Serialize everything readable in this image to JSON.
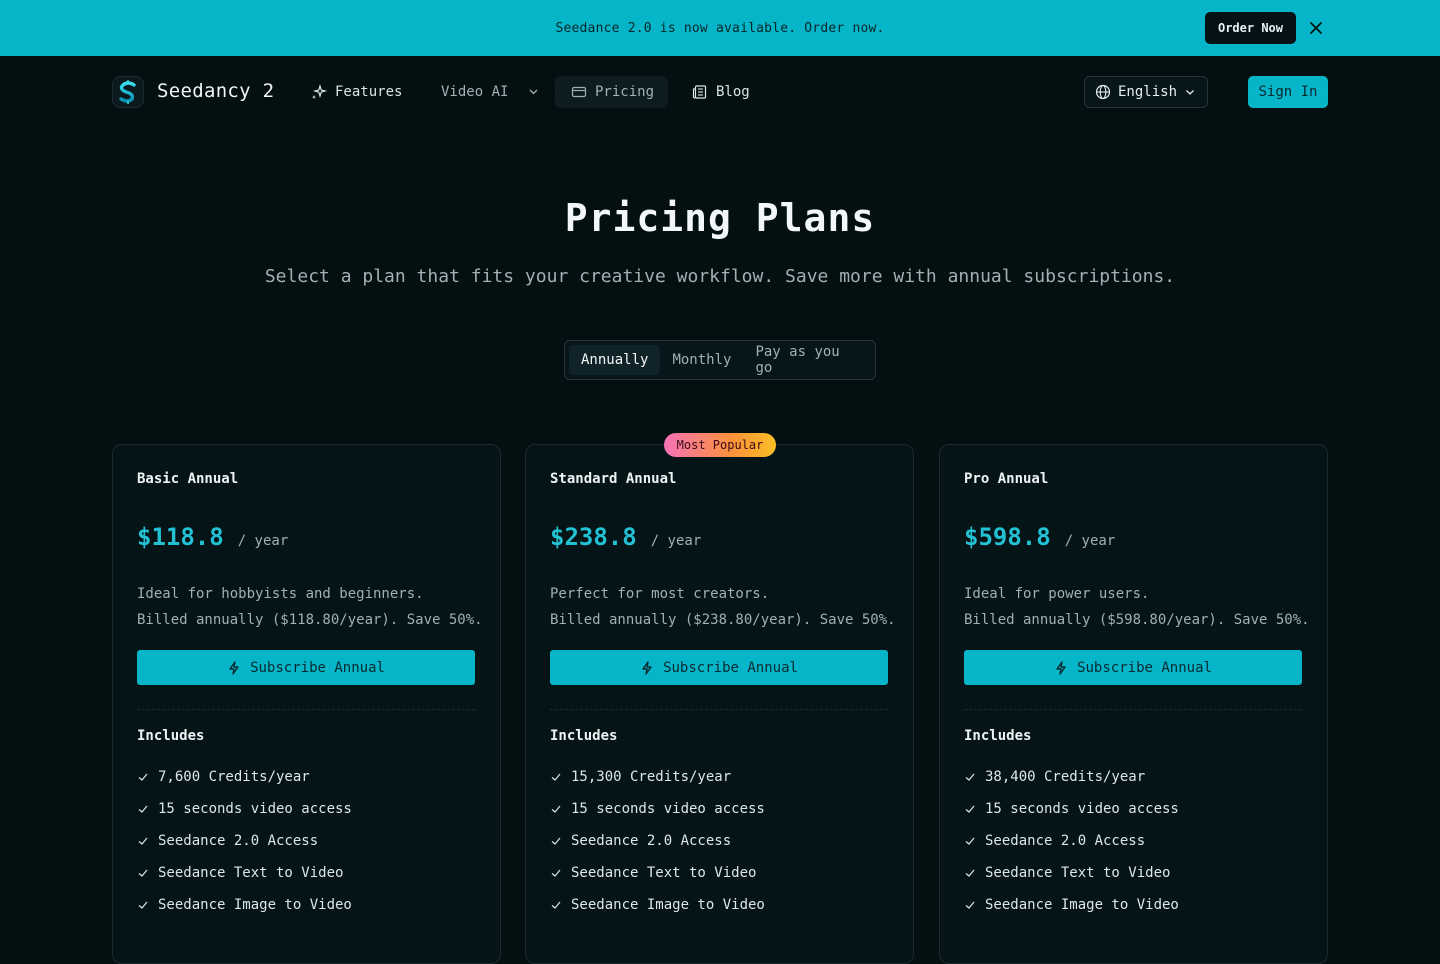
{
  "announcement": {
    "text": "Seedance 2.0 is now available. Order now.",
    "button_label": "Order Now"
  },
  "nav": {
    "brand": "Seedancy 2",
    "items": [
      {
        "label": "Features",
        "icon": "sparkles-icon"
      },
      {
        "label": "Video AI",
        "icon": "chevron-down-icon"
      },
      {
        "label": "Pricing",
        "icon": "credit-card-icon"
      },
      {
        "label": "Blog",
        "icon": "newspaper-icon"
      }
    ],
    "language": "English",
    "signin_label": "Sign In"
  },
  "hero": {
    "title": "Pricing Plans",
    "subtitle": "Select a plan that fits your creative workflow. Save more with annual subscriptions."
  },
  "billing_toggle": {
    "options": [
      "Annually",
      "Monthly",
      "Pay as you go"
    ],
    "selected": "Annually"
  },
  "popular_badge": "Most Popular",
  "plans": [
    {
      "name": "Basic Annual",
      "price": "$118.8",
      "period": "/ year",
      "desc_line1": "Ideal for hobbyists and beginners.",
      "desc_line2": "Billed annually ($118.80/year). Save 50%.",
      "button": "Subscribe Annual",
      "includes_label": "Includes",
      "features": [
        "7,600 Credits/year",
        "15 seconds video access",
        "Seedance 2.0 Access",
        "Seedance Text to Video",
        "Seedance Image to Video"
      ]
    },
    {
      "name": "Standard Annual",
      "price": "$238.8",
      "period": "/ year",
      "desc_line1": "Perfect for most creators.",
      "desc_line2": "Billed annually ($238.80/year). Save 50%.",
      "button": "Subscribe Annual",
      "includes_label": "Includes",
      "features": [
        "15,300 Credits/year",
        "15 seconds video access",
        "Seedance 2.0 Access",
        "Seedance Text to Video",
        "Seedance Image to Video"
      ]
    },
    {
      "name": "Pro Annual",
      "price": "$598.8",
      "period": "/ year",
      "desc_line1": "Ideal for power users.",
      "desc_line2": "Billed annually ($598.80/year). Save 50%.",
      "button": "Subscribe Annual",
      "includes_label": "Includes",
      "features": [
        "38,400 Credits/year",
        "15 seconds video access",
        "Seedance 2.0 Access",
        "Seedance Text to Video",
        "Seedance Image to Video"
      ]
    }
  ],
  "colors": {
    "accent": "#06b6c8",
    "background": "#030f11",
    "price": "#22c2d4"
  }
}
